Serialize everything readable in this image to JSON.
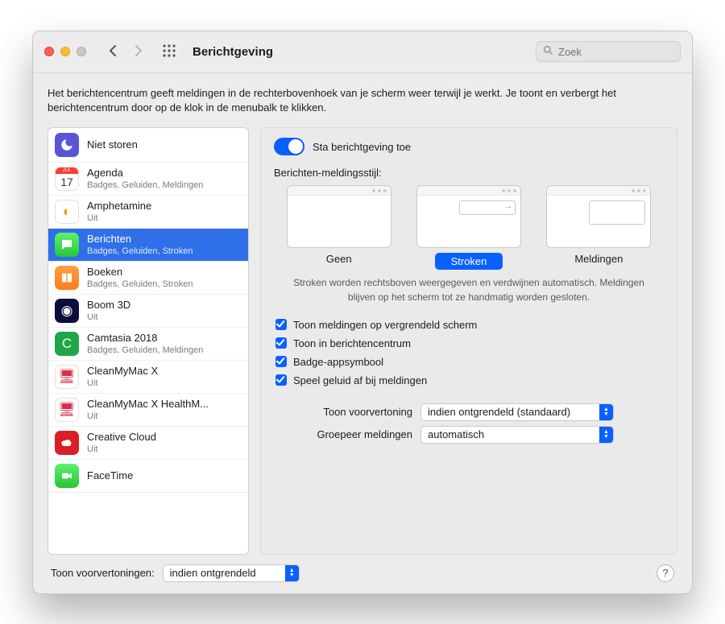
{
  "toolbar": {
    "title": "Berichtgeving",
    "search_placeholder": "Zoek"
  },
  "description": "Het berichtencentrum geeft meldingen in de rechterbovenhoek van je scherm weer terwijl je werkt. Je toont en verbergt het berichtencentrum door op de klok in de menubalk te klikken.",
  "sidebar": {
    "do_not_disturb": "Niet storen",
    "calendar_day": "17",
    "items": [
      {
        "label": "Agenda",
        "sub": "Badges, Geluiden, Meldingen"
      },
      {
        "label": "Amphetamine",
        "sub": "Uit"
      },
      {
        "label": "Berichten",
        "sub": "Badges, Geluiden, Stroken"
      },
      {
        "label": "Boeken",
        "sub": "Badges, Geluiden, Stroken"
      },
      {
        "label": "Boom 3D",
        "sub": "Uit"
      },
      {
        "label": "Camtasia 2018",
        "sub": "Badges, Geluiden, Meldingen"
      },
      {
        "label": "CleanMyMac X",
        "sub": "Uit"
      },
      {
        "label": "CleanMyMac X HealthM...",
        "sub": "Uit"
      },
      {
        "label": "Creative Cloud",
        "sub": "Uit"
      },
      {
        "label": "FaceTime",
        "sub": ""
      }
    ]
  },
  "detail": {
    "allow": "Sta berichtgeving toe",
    "style_label": "Berichten-meldingsstijl:",
    "styles": {
      "none": "Geen",
      "banners": "Stroken",
      "alerts": "Meldingen"
    },
    "explain": "Stroken worden rechtsboven weergegeven en verdwijnen automatisch. Meldingen blijven op het scherm tot ze handmatig worden gesloten.",
    "checks": {
      "lock": "Toon meldingen op vergrendeld scherm",
      "nc": "Toon in berichtencentrum",
      "badge": "Badge-appsymbool",
      "sound": "Speel geluid af bij meldingen"
    },
    "preview_label": "Toon voorvertoning",
    "preview_value": "indien ontgrendeld (standaard)",
    "group_label": "Groepeer meldingen",
    "group_value": "automatisch"
  },
  "footer": {
    "label": "Toon voorvertoningen:",
    "value": "indien ontgrendeld"
  }
}
